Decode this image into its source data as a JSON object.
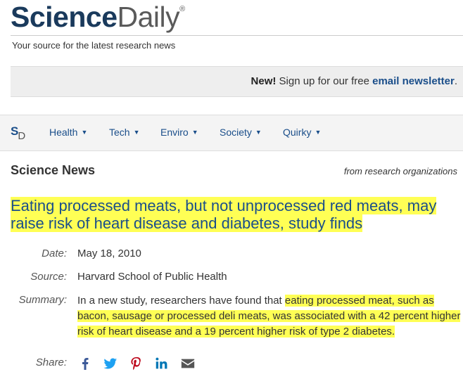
{
  "brand": {
    "science": "Science",
    "daily": "Daily",
    "reg": "®",
    "tagline": "Your source for the latest research news"
  },
  "newsletter": {
    "new_label": "New!",
    "text": " Sign up for our free ",
    "link": "email newsletter",
    "end": "."
  },
  "nav": {
    "logo_s": "S",
    "logo_d": "D",
    "items": [
      {
        "label": "Health"
      },
      {
        "label": "Tech"
      },
      {
        "label": "Enviro"
      },
      {
        "label": "Society"
      },
      {
        "label": "Quirky"
      }
    ]
  },
  "section": {
    "title": "Science News",
    "source_note": "from research organizations"
  },
  "article": {
    "headline": "Eating processed meats, but not unprocessed red meats, may raise risk of heart disease and diabetes, study finds",
    "date_label": "Date:",
    "date": "May 18, 2010",
    "source_label": "Source:",
    "source": "Harvard School of Public Health",
    "summary_label": "Summary:",
    "summary_plain": "In a new study, researchers have found that ",
    "summary_highlight": "eating processed meat, such as bacon, sausage or processed deli meats, was associated with a 42 percent higher risk of heart disease and a 19 percent higher risk of type 2 diabetes.",
    "share_label": "Share:"
  },
  "share": [
    {
      "icon": "facebook-icon",
      "color": "#3b5998"
    },
    {
      "icon": "twitter-icon",
      "color": "#1da1f2"
    },
    {
      "icon": "pinterest-icon",
      "color": "#bd081c"
    },
    {
      "icon": "linkedin-icon",
      "color": "#0077b5"
    },
    {
      "icon": "email-icon",
      "color": "#555555"
    }
  ],
  "colors": {
    "brand_blue": "#1a3a5c",
    "link_blue": "#1a4e8a",
    "highlight": "#ffff55"
  }
}
